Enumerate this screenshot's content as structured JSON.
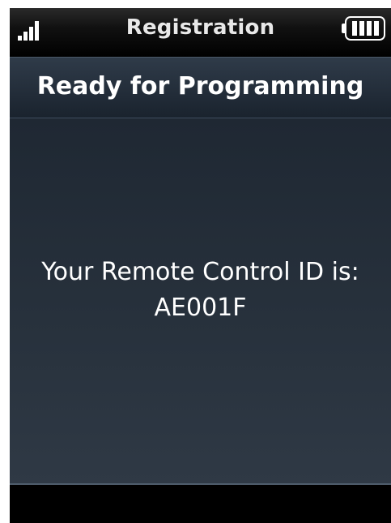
{
  "status_bar": {
    "title": "Registration",
    "signal_icon": "signal-strength-icon",
    "battery_icon": "battery-icon"
  },
  "header": {
    "title": "Ready for Programming"
  },
  "content": {
    "line1": "Your Remote Control ID is:",
    "remote_id": "AE001F"
  },
  "colors": {
    "background": "#000000",
    "header_bg": "#2f3b49",
    "content_bg": "#27313c",
    "text": "#ffffff",
    "accent": "#4e5c6b"
  }
}
